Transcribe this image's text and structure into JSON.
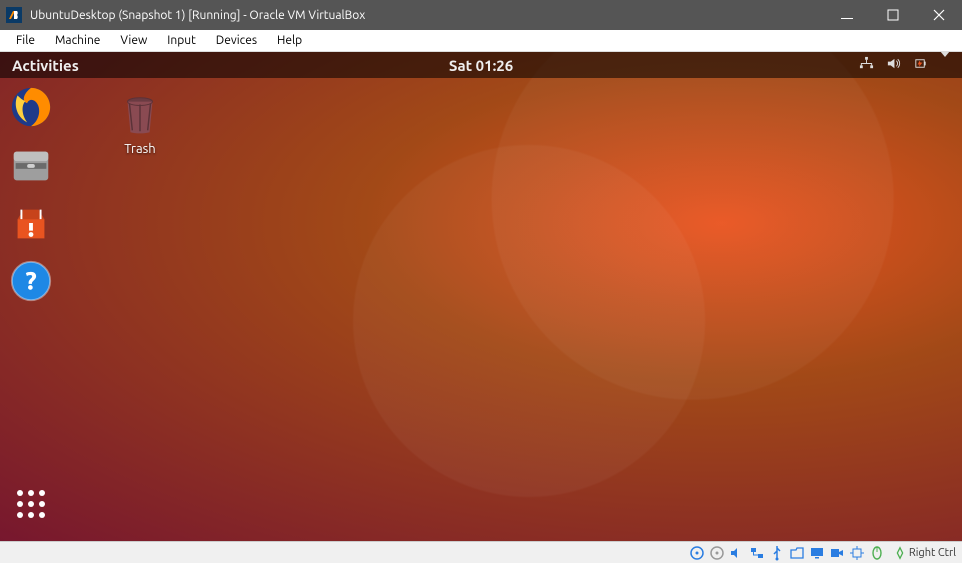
{
  "virtualbox": {
    "title": "UbuntuDesktop (Snapshot 1) [Running] - Oracle VM VirtualBox",
    "menu": {
      "file": "File",
      "machine": "Machine",
      "view": "View",
      "input": "Input",
      "devices": "Devices",
      "help": "Help"
    },
    "hostkey": "Right Ctrl"
  },
  "ubuntu": {
    "activities": "Activities",
    "clock": "Sat 01:26",
    "desktop": {
      "trash": "Trash"
    },
    "dock": {
      "firefox": "Firefox",
      "files": "Files",
      "software": "Ubuntu Software",
      "help": "Help",
      "showapps": "Show Applications"
    }
  }
}
